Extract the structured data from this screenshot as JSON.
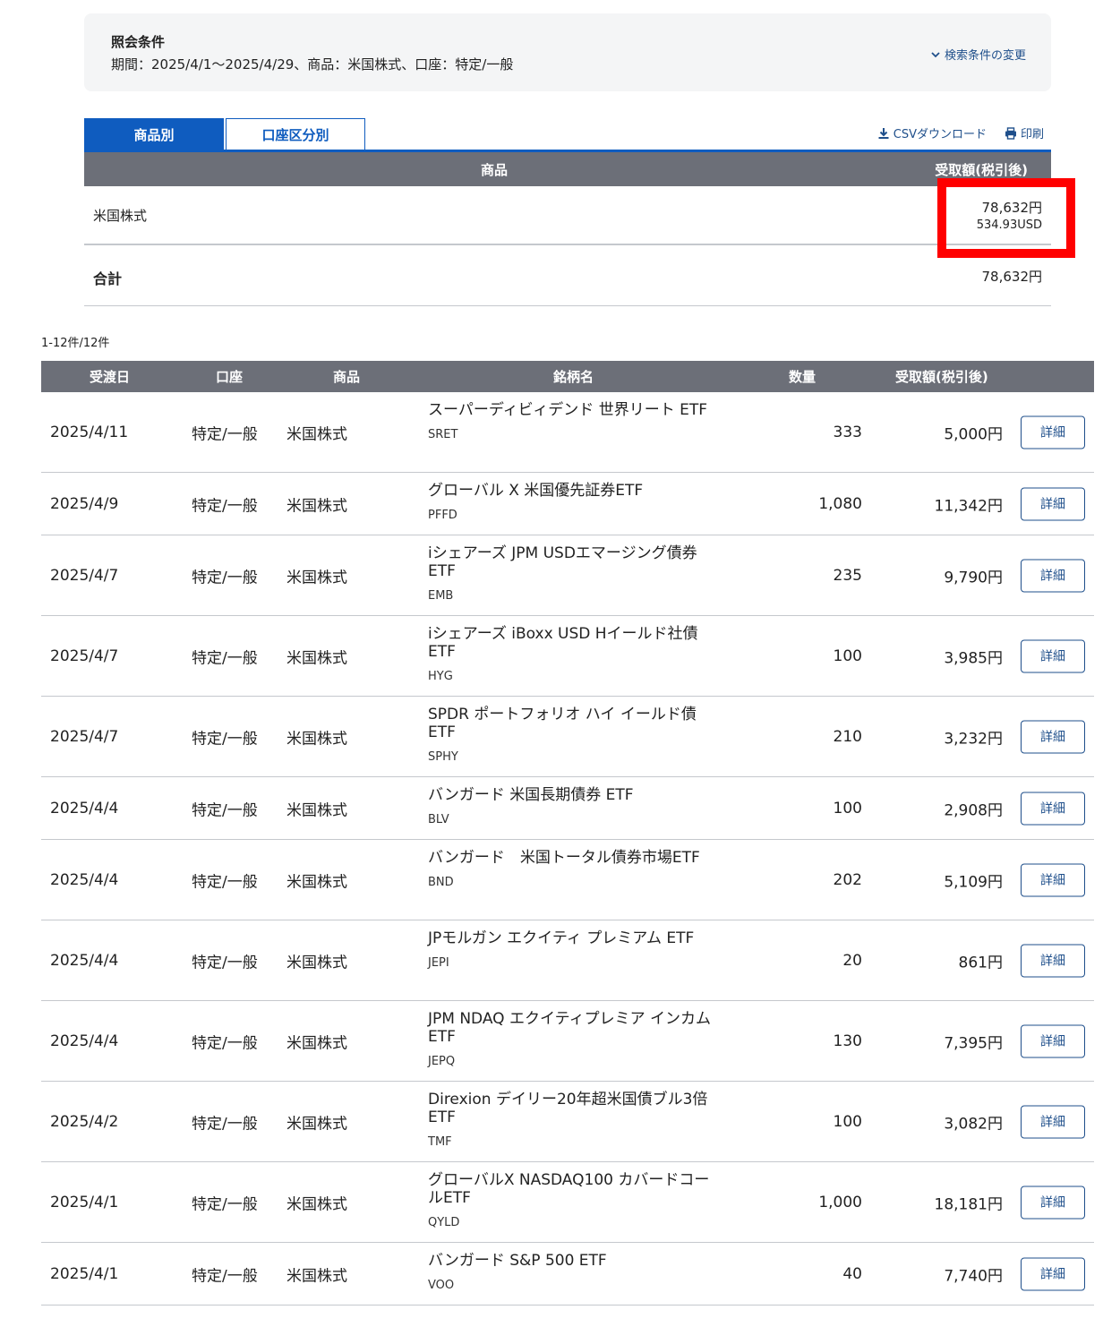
{
  "conditions": {
    "title": "照会条件",
    "text": "期間：2025/4/1～2025/4/29、商品：米国株式、口座：特定/一般",
    "change_label": "検索条件の変更"
  },
  "tabs": [
    {
      "label": "商品別",
      "active": true
    },
    {
      "label": "口座区分別",
      "active": false
    }
  ],
  "tools": {
    "csv_label": "CSVダウンロード",
    "print_label": "印刷"
  },
  "summary": {
    "header_product": "商品",
    "header_amount": "受取額(税引後)",
    "row_label": "米国株式",
    "row_yen": "78,632円",
    "row_usd": "534.93USD",
    "total_label": "合計",
    "total_yen": "78,632円"
  },
  "count_text": "1-12件/12件",
  "detail": {
    "headers": {
      "date": "受渡日",
      "account": "口座",
      "product": "商品",
      "name": "銘柄名",
      "qty": "数量",
      "amount": "受取額(税引後)"
    },
    "button_label": "詳細",
    "rows": [
      {
        "date": "2025/4/11",
        "account": "特定/一般",
        "product": "米国株式",
        "name": "スーパーディビィデンド 世界リート ETF",
        "ticker": "SRET",
        "qty": "333",
        "amount": "5,000円"
      },
      {
        "date": "2025/4/9",
        "account": "特定/一般",
        "product": "米国株式",
        "name": "グローバル X 米国優先証券ETF",
        "ticker": "PFFD",
        "qty": "1,080",
        "amount": "11,342円"
      },
      {
        "date": "2025/4/7",
        "account": "特定/一般",
        "product": "米国株式",
        "name": "iシェアーズ JPM USDエマージング債券 ETF",
        "ticker": "EMB",
        "qty": "235",
        "amount": "9,790円"
      },
      {
        "date": "2025/4/7",
        "account": "特定/一般",
        "product": "米国株式",
        "name": "iシェアーズ iBoxx USD Hイールド社債 ETF",
        "ticker": "HYG",
        "qty": "100",
        "amount": "3,985円"
      },
      {
        "date": "2025/4/7",
        "account": "特定/一般",
        "product": "米国株式",
        "name": "SPDR ポートフォリオ ハイ イールド債 ETF",
        "ticker": "SPHY",
        "qty": "210",
        "amount": "3,232円"
      },
      {
        "date": "2025/4/4",
        "account": "特定/一般",
        "product": "米国株式",
        "name": "バンガード 米国長期債券 ETF",
        "ticker": "BLV",
        "qty": "100",
        "amount": "2,908円"
      },
      {
        "date": "2025/4/4",
        "account": "特定/一般",
        "product": "米国株式",
        "name": "バンガード　米国トータル債券市場ETF",
        "ticker": "BND",
        "qty": "202",
        "amount": "5,109円"
      },
      {
        "date": "2025/4/4",
        "account": "特定/一般",
        "product": "米国株式",
        "name": "JPモルガン エクイティ プレミアム ETF",
        "ticker": "JEPI",
        "qty": "20",
        "amount": "861円"
      },
      {
        "date": "2025/4/4",
        "account": "特定/一般",
        "product": "米国株式",
        "name": "JPM NDAQ エクイティプレミア インカム ETF",
        "ticker": "JEPQ",
        "qty": "130",
        "amount": "7,395円"
      },
      {
        "date": "2025/4/2",
        "account": "特定/一般",
        "product": "米国株式",
        "name": "Direxion デイリー20年超米国債ブル3倍 ETF",
        "ticker": "TMF",
        "qty": "100",
        "amount": "3,082円"
      },
      {
        "date": "2025/4/1",
        "account": "特定/一般",
        "product": "米国株式",
        "name": "グローバルX NASDAQ100 カバードコールETF",
        "ticker": "QYLD",
        "qty": "1,000",
        "amount": "18,181円"
      },
      {
        "date": "2025/4/1",
        "account": "特定/一般",
        "product": "米国株式",
        "name": "バンガード S&P 500 ETF",
        "ticker": "VOO",
        "qty": "40",
        "amount": "7,740円"
      }
    ]
  },
  "colors": {
    "tab_blue": "#0f5cbf",
    "header_gray": "#6c6f78",
    "highlight_red": "#ff0000",
    "link_blue": "#1f4f8b"
  }
}
